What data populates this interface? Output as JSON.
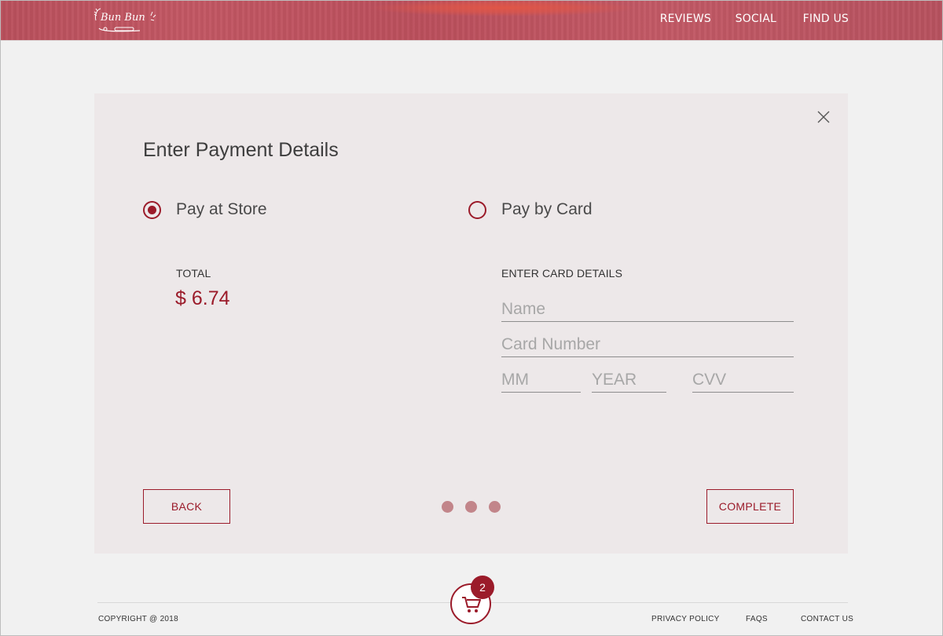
{
  "header": {
    "logo_text": "Bun Bun",
    "nav": [
      "REVIEWS",
      "SOCIAL",
      "FIND US"
    ]
  },
  "modal": {
    "title": "Enter Payment Details",
    "options": [
      {
        "label": "Pay at Store",
        "selected": true
      },
      {
        "label": "Pay by Card",
        "selected": false
      }
    ],
    "total_label": "TOTAL",
    "total_value": "$ 6.74",
    "card_heading": "ENTER CARD DETAILS",
    "fields": {
      "name": {
        "value": "",
        "placeholder": "Name"
      },
      "card_number": {
        "value": "",
        "placeholder": "Card Number"
      },
      "month": {
        "value": "",
        "placeholder": "MM"
      },
      "year": {
        "value": "",
        "placeholder": "YEAR"
      },
      "cvv": {
        "value": "",
        "placeholder": "CVV"
      }
    },
    "back_label": "BACK",
    "complete_label": "COMPLETE",
    "steps": 3
  },
  "footer": {
    "copyright": "COPYRIGHT @ 2018",
    "links": [
      "PRIVACY POLICY",
      "FAQS",
      "CONTACT US"
    ]
  },
  "cart": {
    "count": "2"
  },
  "colors": {
    "accent": "#9b1b2a",
    "header_bg": "#bd5460",
    "modal_bg": "#ede8e9",
    "page_bg": "#f1f1f1",
    "dot": "#c2858a"
  },
  "icons": {
    "close": "close-icon",
    "cart": "cart-icon",
    "logo": "whisk-rolling-pin-logo"
  }
}
